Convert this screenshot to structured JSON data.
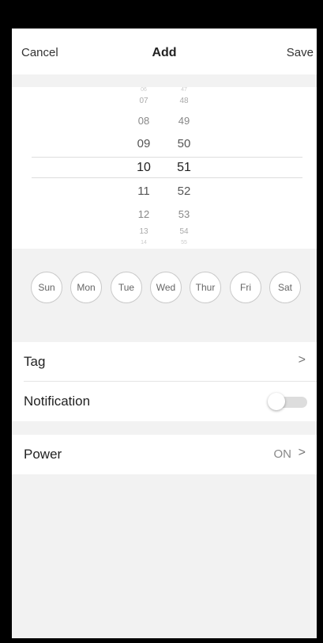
{
  "header": {
    "cancel_label": "Cancel",
    "title": "Add",
    "save_label": "Save"
  },
  "time_picker": {
    "hours": [
      "06",
      "07",
      "08",
      "09",
      "10",
      "11",
      "12",
      "13",
      "14"
    ],
    "minutes": [
      "47",
      "48",
      "49",
      "50",
      "51",
      "52",
      "53",
      "54",
      "55"
    ],
    "selected_hour": "10",
    "selected_minute": "51"
  },
  "repeat_days": [
    "Sun",
    "Mon",
    "Tue",
    "Wed",
    "Thur",
    "Fri",
    "Sat"
  ],
  "settings": {
    "tag_label": "Tag",
    "notification_label": "Notification",
    "notification_enabled": false,
    "power_label": "Power",
    "power_value": "ON"
  },
  "icons": {
    "chevron": "chevron-right-icon",
    "toggle": "toggle-switch-icon"
  },
  "colors": {
    "background": "#f2f2f2",
    "card": "#ffffff",
    "toggle_off": "#dddddd",
    "divider": "#dddddd"
  }
}
